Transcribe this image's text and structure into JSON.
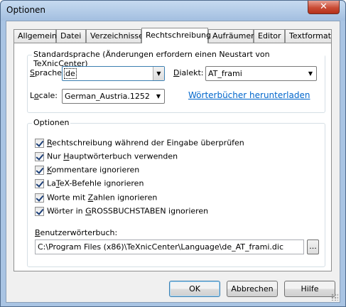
{
  "window": {
    "title": "Optionen",
    "close_symbol": "✕"
  },
  "tabs": [
    {
      "label": "Allgemein"
    },
    {
      "label": "Datei"
    },
    {
      "label": "Verzeichnisse"
    },
    {
      "label": "Rechtschreibung"
    },
    {
      "label": "Aufräumen"
    },
    {
      "label": "Editor"
    },
    {
      "label": "Textformat"
    }
  ],
  "standard": {
    "title": "Standardsprache (Änderungen erfordern einen Neustart von TeXnicCenter)",
    "sprache_label_u": "S",
    "sprache_label_rest": "prache:",
    "sprache_value": "de",
    "dialekt_label_u": "D",
    "dialekt_label_rest": "ialekt:",
    "dialekt_value": "AT_frami",
    "locale_label_pre": "L",
    "locale_label_u": "o",
    "locale_label_rest": "cale:",
    "locale_value": "German_Austria.1252",
    "download_link": "Wörterbücher herunterladen"
  },
  "options": {
    "title": "Optionen",
    "items": [
      {
        "pre": "",
        "u": "R",
        "rest": "echtschreibung während der Eingabe überprüfen",
        "checked": true
      },
      {
        "pre": "Nur ",
        "u": "H",
        "rest": "auptwörterbuch verwenden",
        "checked": true
      },
      {
        "pre": "",
        "u": "K",
        "rest": "ommentare ignorieren",
        "checked": true
      },
      {
        "pre": "La",
        "u": "T",
        "rest": "eX-Befehle ignorieren",
        "checked": true
      },
      {
        "pre": "Worte mit ",
        "u": "Z",
        "rest": "ahlen ignorieren",
        "checked": true
      },
      {
        "pre": "Wörter in ",
        "u": "G",
        "rest": "ROSSBUCHSTABEN ignorieren",
        "checked": true
      }
    ],
    "user_dict_label_u": "B",
    "user_dict_label_rest": "enutzerwörterbuch:",
    "user_dict_path": "C:\\Program Files (x86)\\TeXnicCenter\\Language\\de_AT_frami.dic",
    "browse_label": "..."
  },
  "buttons": {
    "ok": "OK",
    "cancel": "Abbrechen",
    "help": "Hilfe"
  }
}
